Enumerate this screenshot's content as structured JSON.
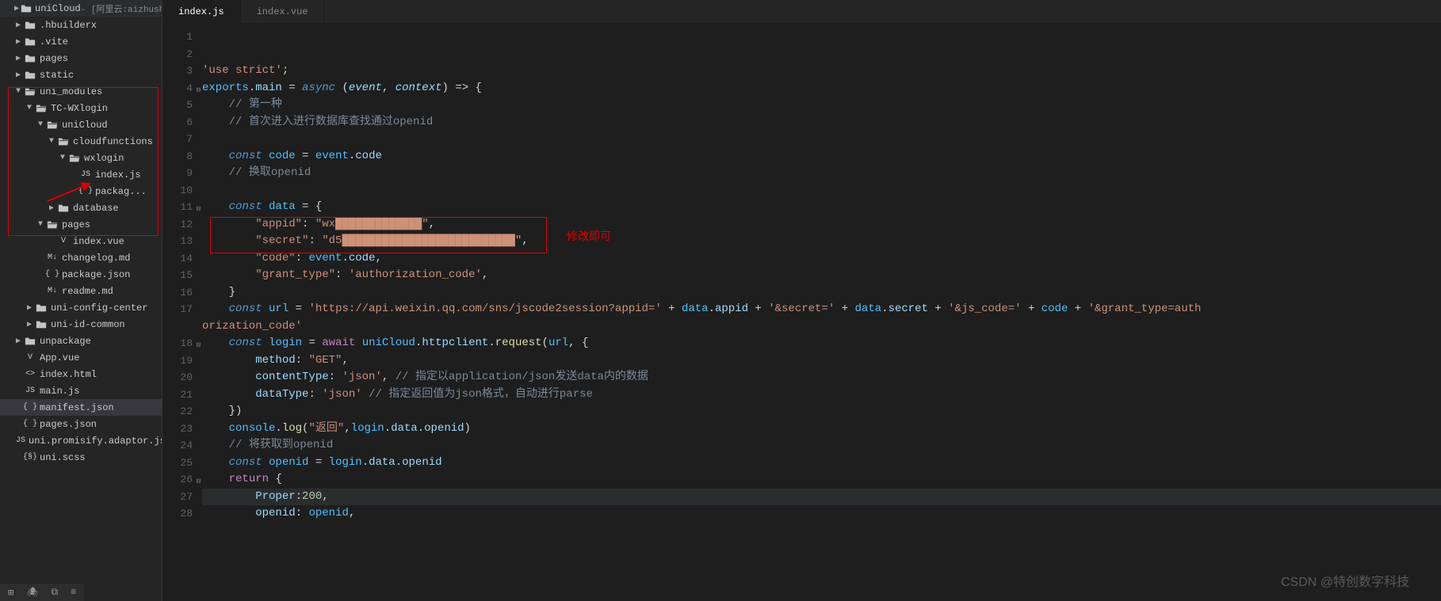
{
  "tabs": [
    {
      "label": "index.js",
      "active": true
    },
    {
      "label": "index.vue",
      "active": false
    }
  ],
  "annotation": "修改即可",
  "watermark": "CSDN @特创数字科技",
  "sidebar": {
    "items": [
      {
        "indent": 0,
        "chev": "▶",
        "icon": "folder",
        "label": "uniCloud",
        "suffix": " - [阿里云:aizhushou]"
      },
      {
        "indent": 0,
        "chev": "▶",
        "icon": "folder",
        "label": ".hbuilderx"
      },
      {
        "indent": 0,
        "chev": "▶",
        "icon": "folder",
        "label": ".vite"
      },
      {
        "indent": 0,
        "chev": "▶",
        "icon": "folder",
        "label": "pages"
      },
      {
        "indent": 0,
        "chev": "▶",
        "icon": "folder",
        "label": "static"
      },
      {
        "indent": 0,
        "chev": "▼",
        "icon": "folder-open",
        "label": "uni_modules"
      },
      {
        "indent": 1,
        "chev": "▼",
        "icon": "folder-open",
        "label": "TC-WXlogin"
      },
      {
        "indent": 2,
        "chev": "▼",
        "icon": "folder-open",
        "label": "uniCloud"
      },
      {
        "indent": 3,
        "chev": "▼",
        "icon": "folder-open",
        "label": "cloudfunctions"
      },
      {
        "indent": 4,
        "chev": "▼",
        "icon": "folder-open",
        "label": "wxlogin"
      },
      {
        "indent": 5,
        "chev": "",
        "icon": "js",
        "label": "index.js"
      },
      {
        "indent": 5,
        "chev": "",
        "icon": "json",
        "label": "packag..."
      },
      {
        "indent": 3,
        "chev": "▶",
        "icon": "folder",
        "label": "database"
      },
      {
        "indent": 2,
        "chev": "▼",
        "icon": "folder-open",
        "label": "pages"
      },
      {
        "indent": 3,
        "chev": "",
        "icon": "vue",
        "label": "index.vue"
      },
      {
        "indent": 2,
        "chev": "",
        "icon": "md",
        "label": "changelog.md"
      },
      {
        "indent": 2,
        "chev": "",
        "icon": "json",
        "label": "package.json"
      },
      {
        "indent": 2,
        "chev": "",
        "icon": "md",
        "label": "readme.md"
      },
      {
        "indent": 1,
        "chev": "▶",
        "icon": "folder",
        "label": "uni-config-center"
      },
      {
        "indent": 1,
        "chev": "▶",
        "icon": "folder",
        "label": "uni-id-common"
      },
      {
        "indent": 0,
        "chev": "▶",
        "icon": "folder",
        "label": "unpackage"
      },
      {
        "indent": 0,
        "chev": "",
        "icon": "vue",
        "label": "App.vue"
      },
      {
        "indent": 0,
        "chev": "",
        "icon": "html",
        "label": "index.html"
      },
      {
        "indent": 0,
        "chev": "",
        "icon": "js",
        "label": "main.js"
      },
      {
        "indent": 0,
        "chev": "",
        "icon": "json",
        "label": "manifest.json",
        "selected": true
      },
      {
        "indent": 0,
        "chev": "",
        "icon": "json",
        "label": "pages.json"
      },
      {
        "indent": 0,
        "chev": "",
        "icon": "js",
        "label": "uni.promisify.adaptor.js"
      },
      {
        "indent": 0,
        "chev": "",
        "icon": "scss",
        "label": "uni.scss"
      }
    ]
  },
  "code": {
    "lines": [
      {
        "n": 1,
        "html": ""
      },
      {
        "n": 2,
        "html": ""
      },
      {
        "n": 3,
        "html": "<span class='str'>'use strict'</span><span class='pun'>;</span>"
      },
      {
        "n": 4,
        "fold": true,
        "html": "<span class='var'>exports</span><span class='pun'>.</span><span class='prop'>main</span> <span class='pun'>=</span> <span class='kw'>async</span> <span class='pun'>(</span><span class='param'>event</span><span class='pun'>,</span> <span class='param'>context</span><span class='pun'>) =&gt; {</span>"
      },
      {
        "n": 5,
        "html": "    <span class='com'>// 第一种</span>"
      },
      {
        "n": 6,
        "html": "    <span class='com'>// 首次进入进行数据库查找通过openid</span>"
      },
      {
        "n": 7,
        "html": ""
      },
      {
        "n": 8,
        "html": "    <span class='kw'>const</span> <span class='var'>code</span> <span class='pun'>=</span> <span class='var'>event</span><span class='pun'>.</span><span class='prop'>code</span>"
      },
      {
        "n": 9,
        "html": "    <span class='com'>// 换取openid</span>"
      },
      {
        "n": 10,
        "html": ""
      },
      {
        "n": 11,
        "fold": true,
        "html": "    <span class='kw'>const</span> <span class='var'>data</span> <span class='pun'>= {</span>"
      },
      {
        "n": 12,
        "html": "        <span class='str'>\"appid\"</span><span class='pun'>:</span> <span class='str'>\"wx█████████████\"</span><span class='pun'>,</span>"
      },
      {
        "n": 13,
        "html": "        <span class='str'>\"secret\"</span><span class='pun'>:</span> <span class='str'>\"d5██████████████████████████\"</span><span class='pun'>,</span>"
      },
      {
        "n": 14,
        "html": "        <span class='str'>\"code\"</span><span class='pun'>:</span> <span class='var'>event</span><span class='pun'>.</span><span class='prop'>code</span><span class='pun'>,</span>"
      },
      {
        "n": 15,
        "html": "        <span class='str'>\"grant_type\"</span><span class='pun'>:</span> <span class='str'>'authorization_code'</span><span class='pun'>,</span>"
      },
      {
        "n": 16,
        "html": "    <span class='pun'>}</span>"
      },
      {
        "n": 17,
        "html": "    <span class='kw'>const</span> <span class='var'>url</span> <span class='pun'>=</span> <span class='str'>'https://api.weixin.qq.com/sns/jscode2session?appid='</span> <span class='pun'>+</span> <span class='var'>data</span><span class='pun'>.</span><span class='prop'>appid</span> <span class='pun'>+</span> <span class='str'>'&amp;secret='</span> <span class='pun'>+</span> <span class='var'>data</span><span class='pun'>.</span><span class='prop'>secret</span> <span class='pun'>+</span> <span class='str'>'&amp;js_code='</span> <span class='pun'>+</span> <span class='var'>code</span> <span class='pun'>+</span> <span class='str'>'&amp;grant_type=auth</span>"
      },
      {
        "n": 0,
        "html": "<span class='str'>orization_code'</span>",
        "cont": true
      },
      {
        "n": 18,
        "fold": true,
        "html": "    <span class='kw'>const</span> <span class='var'>login</span> <span class='pun'>=</span> <span class='kw2'>await</span> <span class='var'>uniCloud</span><span class='pun'>.</span><span class='prop'>httpclient</span><span class='pun'>.</span><span class='fn'>request</span><span class='pun'>(</span><span class='var'>url</span><span class='pun'>, {</span>"
      },
      {
        "n": 19,
        "html": "        <span class='prop'>method</span><span class='pun'>:</span> <span class='str'>\"GET\"</span><span class='pun'>,</span>"
      },
      {
        "n": 20,
        "html": "        <span class='prop'>contentType</span><span class='pun'>:</span> <span class='str'>'json'</span><span class='pun'>,</span> <span class='com'>// 指定以application/json发送data内的数据</span>"
      },
      {
        "n": 21,
        "html": "        <span class='prop'>dataType</span><span class='pun'>:</span> <span class='str'>'json'</span> <span class='com'>// 指定返回值为json格式，自动进行parse</span>"
      },
      {
        "n": 22,
        "html": "    <span class='pun'>})</span>"
      },
      {
        "n": 23,
        "html": "    <span class='var'>console</span><span class='pun'>.</span><span class='fn'>log</span><span class='pun'>(</span><span class='str'>\"返回\"</span><span class='pun'>,</span><span class='var'>login</span><span class='pun'>.</span><span class='prop'>data</span><span class='pun'>.</span><span class='prop'>openid</span><span class='pun'>)</span>"
      },
      {
        "n": 24,
        "html": "    <span class='com'>// 将获取到openid</span>"
      },
      {
        "n": 25,
        "html": "    <span class='kw'>const</span> <span class='var'>openid</span> <span class='pun'>=</span> <span class='var'>login</span><span class='pun'>.</span><span class='prop'>data</span><span class='pun'>.</span><span class='prop'>openid</span>"
      },
      {
        "n": 26,
        "fold": true,
        "html": "    <span class='kw2'>return</span> <span class='pun'>{</span>"
      },
      {
        "n": 27,
        "hl": true,
        "html": "        <span class='prop'>Proper</span><span class='pun'>:</span><span class='num'>200</span><span class='pun'>,</span>"
      },
      {
        "n": 28,
        "html": "        <span class='prop'>openid</span><span class='pun'>:</span> <span class='var'>openid</span><span class='pun'>,</span>"
      }
    ]
  },
  "status_icons": [
    "⊞",
    "🐞",
    "⚙",
    "☰"
  ]
}
